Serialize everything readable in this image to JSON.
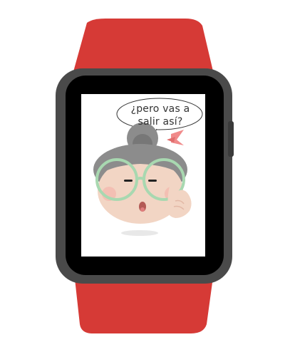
{
  "screen": {
    "speech_bubble": {
      "line1": "¿pero vas a",
      "line2": "salir así?"
    },
    "character_icon": "grandma-glasses-finger-icon"
  },
  "colors": {
    "band": "#d63a36",
    "case": "#4a4a4a",
    "bezel": "#000000",
    "screen": "#ffffff",
    "hair": "#8c8c8c",
    "glasses": "#a8d8b0",
    "skin": "#f2d5c4",
    "bow": "#f08a8a"
  }
}
